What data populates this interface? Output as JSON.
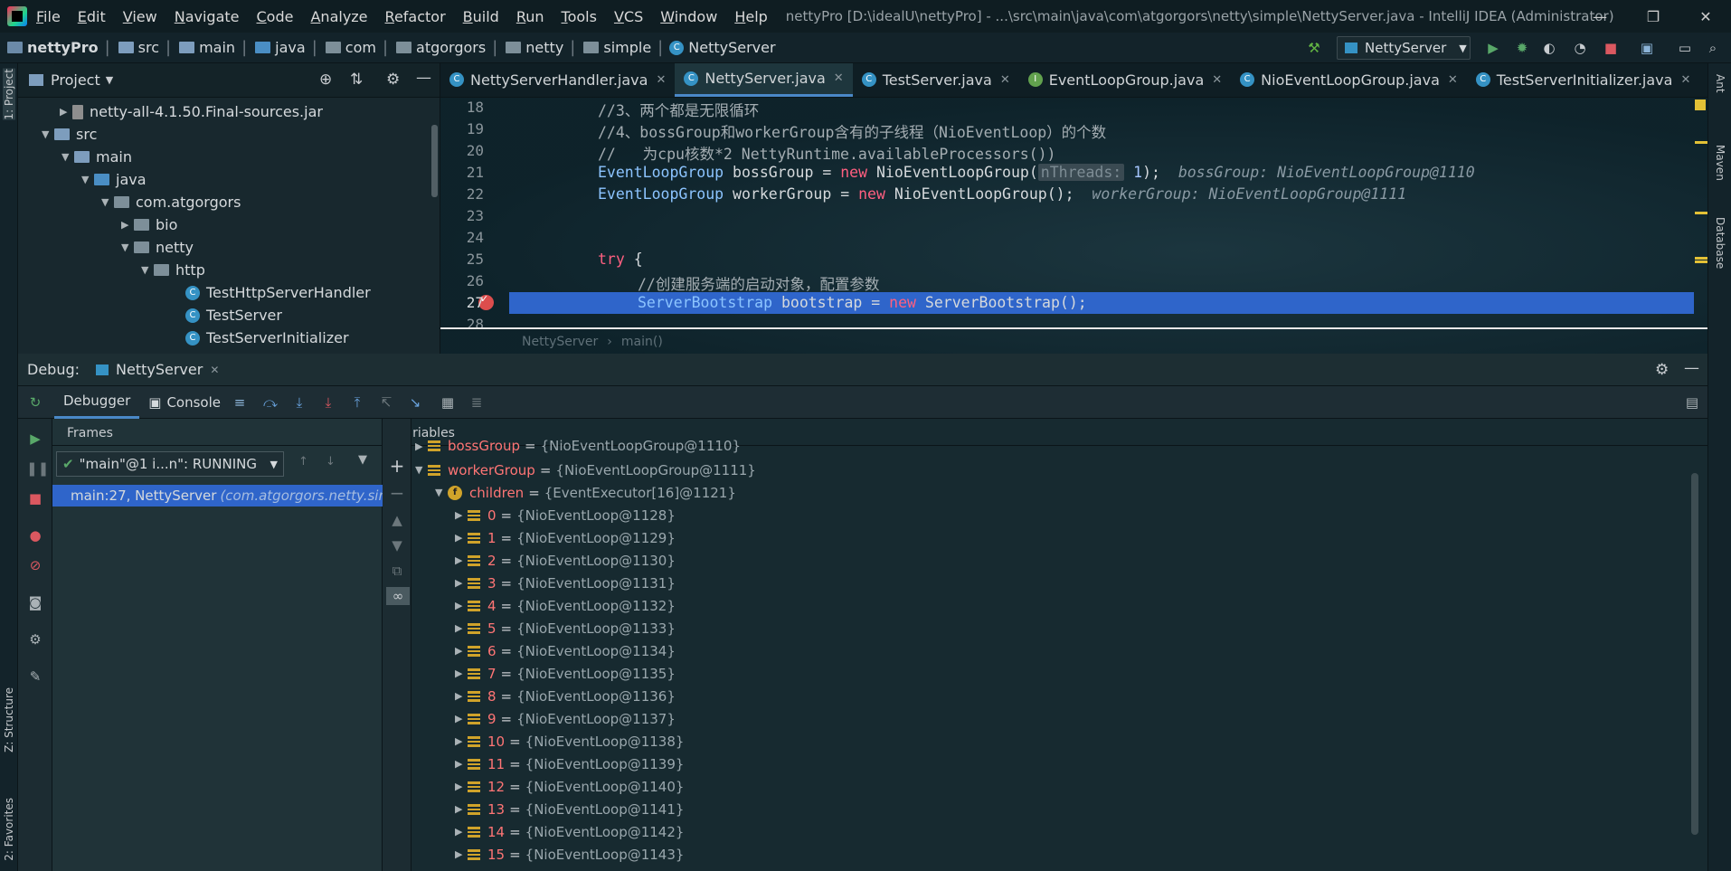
{
  "menu": [
    "File",
    "Edit",
    "View",
    "Navigate",
    "Code",
    "Analyze",
    "Refactor",
    "Build",
    "Run",
    "Tools",
    "VCS",
    "Window",
    "Help"
  ],
  "window_title": "nettyPro [D:\\idealU\\nettyPro] - ...\\src\\main\\java\\com\\atgorgors\\netty\\simple\\NettyServer.java - IntelliJ IDEA (Administrator)",
  "breadcrumb": {
    "project": "nettyPro",
    "parts": [
      "src",
      "main",
      "java",
      "com",
      "atgorgors",
      "netty",
      "simple"
    ],
    "file": "NettyServer"
  },
  "run_config": "NettyServer",
  "left_strip": {
    "project": "1: Project",
    "structure": "Z: Structure",
    "favorites": "2: Favorites"
  },
  "right_strip": {
    "ant": "Ant",
    "maven": "Maven",
    "database": "Database"
  },
  "project_panel": {
    "title": "Project",
    "rows": [
      {
        "label": "netty-all-4.1.50.Final-sources.jar",
        "kind": "jar",
        "tri": "▶"
      },
      {
        "label": "src",
        "kind": "src",
        "tri": "▼"
      },
      {
        "label": "main",
        "kind": "src",
        "tri": "▼"
      },
      {
        "label": "java",
        "kind": "java",
        "tri": "▼"
      },
      {
        "label": "com.atgorgors",
        "kind": "pkg",
        "tri": "▼"
      },
      {
        "label": "bio",
        "kind": "pkg",
        "tri": "▶"
      },
      {
        "label": "netty",
        "kind": "pkg",
        "tri": "▼"
      },
      {
        "label": "http",
        "kind": "pkg",
        "tri": "▼"
      },
      {
        "label": "TestHttpServerHandler",
        "kind": "class",
        "tri": ""
      },
      {
        "label": "TestServer",
        "kind": "class",
        "tri": ""
      },
      {
        "label": "TestServerInitializer",
        "kind": "class",
        "tri": ""
      }
    ]
  },
  "editor_tabs": [
    {
      "label": "NettyServerHandler.java",
      "icon": "C",
      "active": false
    },
    {
      "label": "NettyServer.java",
      "icon": "C",
      "active": true
    },
    {
      "label": "TestServer.java",
      "icon": "C",
      "active": false
    },
    {
      "label": "EventLoopGroup.java",
      "icon": "I",
      "active": false
    },
    {
      "label": "NioEventLoopGroup.java",
      "icon": "C",
      "active": false
    },
    {
      "label": "TestServerInitializer.java",
      "icon": "C",
      "active": false
    }
  ],
  "code_lines": [
    {
      "n": "18",
      "text": "//3、两个都是无限循环"
    },
    {
      "n": "19",
      "text": "//4、bossGroup和workerGroup含有的子线程（NioEventLoop）的个数"
    },
    {
      "n": "20",
      "text": "//   为cpu核数*2 NettyRuntime.availableProcessors())"
    },
    {
      "n": "21",
      "type": "EventLoopGroup",
      "rest1": " bossGroup = ",
      "kw": "new",
      "rest2": " NioEventLoopGroup(",
      "param": "nThreads:",
      "num": " 1",
      "end": ");",
      "hint": "bossGroup: NioEventLoopGroup@1110"
    },
    {
      "n": "22",
      "type": "EventLoopGroup",
      "rest1": " workerGroup = ",
      "kw": "new",
      "rest2": " NioEventLoopGroup();",
      "hint": "workerGroup: NioEventLoopGroup@1111"
    },
    {
      "n": "23",
      "text": ""
    },
    {
      "n": "24",
      "text": ""
    },
    {
      "n": "25",
      "kw": "try",
      "rest": " {"
    },
    {
      "n": "26",
      "text": "//创建服务端的启动对象，配置参数"
    },
    {
      "n": "27",
      "type": "ServerBootstrap",
      "rest1": " bootstrap = ",
      "kw": "new",
      "rest2": " ServerBootstrap();"
    },
    {
      "n": "28",
      "text": ""
    }
  ],
  "editor_crumb": [
    "NettyServer",
    "main()"
  ],
  "debug": {
    "label": "Debug:",
    "session": "NettyServer",
    "tabs": [
      "Debugger",
      "Console"
    ],
    "frames_title": "Frames",
    "variables_title": "Variables",
    "thread": "\"main\"@1 i...n\": RUNNING",
    "frame": "main:27, NettyServer",
    "frame_pkg": "(com.atgorgors.netty.simp"
  },
  "variables": {
    "boss": {
      "name": "bossGroup",
      "value": "{NioEventLoopGroup@1110}"
    },
    "worker": {
      "name": "workerGroup",
      "value": "{NioEventLoopGroup@1111}"
    },
    "children": {
      "name": "children",
      "value": "{EventExecutor[16]@1121}"
    },
    "items": [
      {
        "name": "0",
        "value": "{NioEventLoop@1128}"
      },
      {
        "name": "1",
        "value": "{NioEventLoop@1129}"
      },
      {
        "name": "2",
        "value": "{NioEventLoop@1130}"
      },
      {
        "name": "3",
        "value": "{NioEventLoop@1131}"
      },
      {
        "name": "4",
        "value": "{NioEventLoop@1132}"
      },
      {
        "name": "5",
        "value": "{NioEventLoop@1133}"
      },
      {
        "name": "6",
        "value": "{NioEventLoop@1134}"
      },
      {
        "name": "7",
        "value": "{NioEventLoop@1135}"
      },
      {
        "name": "8",
        "value": "{NioEventLoop@1136}"
      },
      {
        "name": "9",
        "value": "{NioEventLoop@1137}"
      },
      {
        "name": "10",
        "value": "{NioEventLoop@1138}"
      },
      {
        "name": "11",
        "value": "{NioEventLoop@1139}"
      },
      {
        "name": "12",
        "value": "{NioEventLoop@1140}"
      },
      {
        "name": "13",
        "value": "{NioEventLoop@1141}"
      },
      {
        "name": "14",
        "value": "{NioEventLoop@1142}"
      },
      {
        "name": "15",
        "value": "{NioEventLoop@1143}"
      }
    ]
  },
  "colors": {
    "selection": "#2f65ca",
    "var_name": "#ff7575",
    "keyword": "#ff5f80",
    "type": "#8cc4ff"
  }
}
